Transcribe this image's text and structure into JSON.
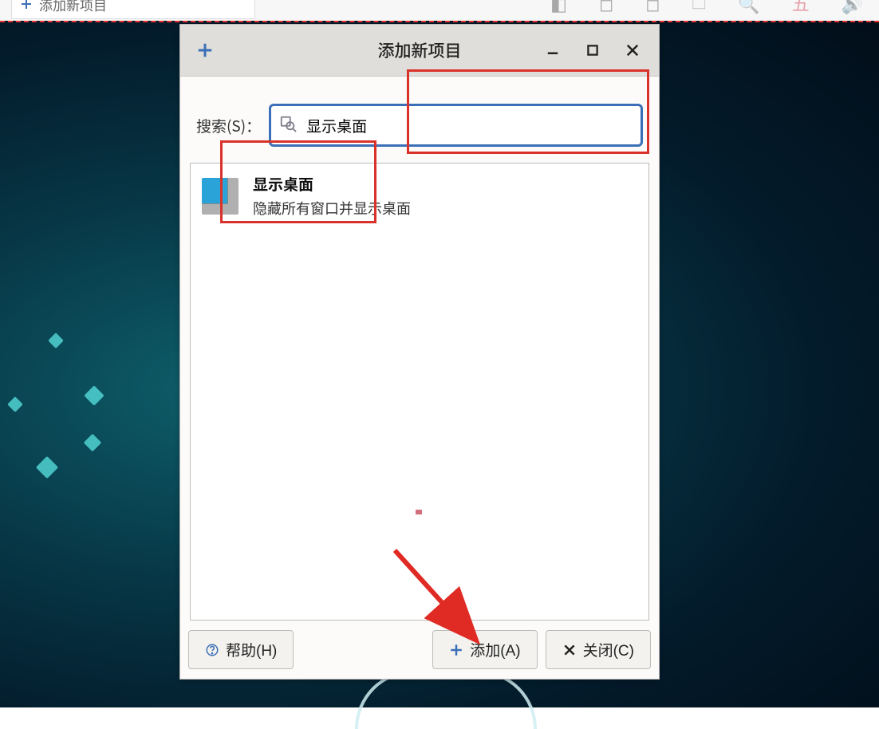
{
  "taskbar": {
    "entry_label": "添加新项目"
  },
  "dialog": {
    "title": "添加新项目",
    "search_label": "搜索(S)：",
    "search_value": "显示桌面",
    "result": {
      "title": "显示桌面",
      "desc": "隐藏所有窗口并显示桌面"
    },
    "buttons": {
      "help": "帮助(H)",
      "add": "添加(A)",
      "close": "关闭(C)"
    }
  }
}
